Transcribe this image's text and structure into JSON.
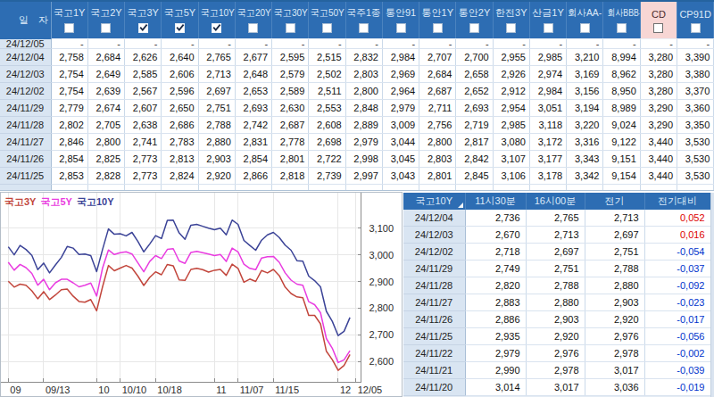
{
  "colors": {
    "header_bg": "#2D6DB3",
    "header_text": "#DCE9F8",
    "highlight_bg": "#F7D6D4",
    "highlight_text": "#4A2B2B",
    "date_col_bg": "#D9E5F2",
    "up": "#DD0000",
    "down": "#0033CC",
    "series_3y": "#C2463C",
    "series_5y": "#E93CE0",
    "series_10y": "#3B4397"
  },
  "yield_grid": {
    "date_header": "일 자",
    "columns": [
      {
        "label": "국고1Y",
        "checked": false,
        "highlighted": false
      },
      {
        "label": "국고2Y",
        "checked": false,
        "highlighted": false
      },
      {
        "label": "국고3Y",
        "checked": true,
        "highlighted": false
      },
      {
        "label": "국고5Y",
        "checked": true,
        "highlighted": false
      },
      {
        "label": "국고10Y",
        "checked": true,
        "highlighted": false
      },
      {
        "label": "국고20Y",
        "checked": false,
        "highlighted": false
      },
      {
        "label": "국고30Y",
        "checked": false,
        "highlighted": false
      },
      {
        "label": "국고50Y",
        "checked": false,
        "highlighted": false
      },
      {
        "label": "국주1종",
        "checked": false,
        "highlighted": false
      },
      {
        "label": "통안91",
        "checked": false,
        "highlighted": false
      },
      {
        "label": "통안1Y",
        "checked": false,
        "highlighted": false
      },
      {
        "label": "통안2Y",
        "checked": false,
        "highlighted": false
      },
      {
        "label": "한전3Y",
        "checked": false,
        "highlighted": false
      },
      {
        "label": "산금1Y",
        "checked": false,
        "highlighted": false
      },
      {
        "label": "회사AA-",
        "checked": false,
        "highlighted": false
      },
      {
        "label": "회사BBB-",
        "checked": false,
        "highlighted": false
      },
      {
        "label": "CD",
        "checked": false,
        "highlighted": true
      },
      {
        "label": "CP91D",
        "checked": false,
        "highlighted": false
      }
    ],
    "rows": [
      {
        "date": "24/12/05",
        "values": [
          "-",
          "-",
          "-",
          "-",
          "-",
          "-",
          "-",
          "-",
          "-",
          "-",
          "-",
          "-",
          "-",
          "-",
          "-",
          "-",
          "-",
          "-"
        ]
      },
      {
        "date": "24/12/04",
        "values": [
          "2,758",
          "2,684",
          "2,626",
          "2,640",
          "2,765",
          "2,677",
          "2,595",
          "2,515",
          "2,832",
          "2,984",
          "2,707",
          "2,700",
          "2,955",
          "2,985",
          "3,210",
          "8,994",
          "3,280",
          "3,390"
        ]
      },
      {
        "date": "24/12/03",
        "values": [
          "2,754",
          "2,649",
          "2,585",
          "2,606",
          "2,713",
          "2,648",
          "2,579",
          "2,502",
          "2,803",
          "2,969",
          "2,684",
          "2,658",
          "2,926",
          "2,974",
          "3,169",
          "8,962",
          "3,280",
          "3,380"
        ]
      },
      {
        "date": "24/12/02",
        "values": [
          "2,754",
          "2,639",
          "2,567",
          "2,596",
          "2,697",
          "2,653",
          "2,589",
          "2,511",
          "2,800",
          "2,964",
          "2,687",
          "2,652",
          "2,912",
          "2,984",
          "3,156",
          "8,950",
          "3,280",
          "3,370"
        ]
      },
      {
        "date": "24/11/29",
        "values": [
          "2,779",
          "2,674",
          "2,607",
          "2,650",
          "2,751",
          "2,693",
          "2,630",
          "2,553",
          "2,848",
          "2,979",
          "2,711",
          "2,693",
          "2,954",
          "3,051",
          "3,194",
          "8,989",
          "3,290",
          "3,360"
        ]
      },
      {
        "date": "24/11/28",
        "values": [
          "2,802",
          "2,705",
          "2,638",
          "2,686",
          "2,788",
          "2,742",
          "2,687",
          "2,608",
          "2,889",
          "3,009",
          "2,756",
          "2,719",
          "2,985",
          "3,118",
          "3,220",
          "9,024",
          "3,290",
          "3,350"
        ]
      },
      {
        "date": "24/11/27",
        "values": [
          "2,846",
          "2,800",
          "2,741",
          "2,783",
          "2,880",
          "2,831",
          "2,778",
          "2,698",
          "2,979",
          "3,044",
          "2,800",
          "2,817",
          "3,080",
          "3,172",
          "3,316",
          "9,122",
          "3,440",
          "3,530"
        ]
      },
      {
        "date": "24/11/26",
        "values": [
          "2,854",
          "2,825",
          "2,773",
          "2,813",
          "2,903",
          "2,854",
          "2,801",
          "2,722",
          "2,998",
          "3,045",
          "2,803",
          "2,842",
          "3,107",
          "3,177",
          "3,343",
          "9,151",
          "3,440",
          "3,530"
        ]
      },
      {
        "date": "24/11/25",
        "values": [
          "2,853",
          "2,828",
          "2,773",
          "2,824",
          "2,920",
          "2,866",
          "2,818",
          "2,739",
          "2,997",
          "3,043",
          "2,801",
          "2,845",
          "3,106",
          "3,178",
          "3,342",
          "9,154",
          "3,440",
          "3,530"
        ]
      }
    ]
  },
  "chart_data": {
    "type": "line",
    "x_axis": {
      "unit": "date",
      "tick_labels": [
        "09",
        "09/13",
        "10",
        "10/10",
        "10/18",
        "11",
        "11/07",
        "11/15",
        "12",
        "12/05"
      ],
      "tick_indices": [
        0,
        6,
        15,
        19,
        25,
        35,
        39,
        45,
        56,
        59
      ]
    },
    "y_axis": {
      "tick_labels": [
        "3,100",
        "3,000",
        "2,900",
        "2,800",
        "2,700",
        "2,600"
      ],
      "tick_values": [
        3.1,
        3.0,
        2.9,
        2.8,
        2.7,
        2.6
      ],
      "min": 2.546,
      "max": 3.235
    },
    "legend_position": "top-left",
    "grid": true,
    "series": [
      {
        "name": "국고3Y",
        "color": "#C2463C",
        "values": [
          2.901,
          2.879,
          2.89,
          2.886,
          2.865,
          2.835,
          2.862,
          2.832,
          2.849,
          2.869,
          2.872,
          2.845,
          2.825,
          2.822,
          2.832,
          2.79,
          2.88,
          2.96,
          2.94,
          2.95,
          2.96,
          2.95,
          2.92,
          2.885,
          2.915,
          2.936,
          2.925,
          2.964,
          2.959,
          2.906,
          2.904,
          2.945,
          2.949,
          2.944,
          2.935,
          2.942,
          2.945,
          2.923,
          2.965,
          2.949,
          2.897,
          2.909,
          2.9,
          2.941,
          2.932,
          2.945,
          2.922,
          2.879,
          2.855,
          2.842,
          2.839,
          2.773,
          2.773,
          2.741,
          2.638,
          2.607,
          2.567,
          2.585,
          2.626
        ]
      },
      {
        "name": "국고5Y",
        "color": "#E93CE0",
        "values": [
          2.972,
          2.942,
          2.964,
          2.952,
          2.93,
          2.886,
          2.908,
          2.869,
          2.895,
          2.908,
          2.908,
          2.895,
          2.88,
          2.886,
          2.894,
          2.845,
          2.95,
          3.018,
          3.001,
          3.008,
          3.011,
          3.003,
          2.97,
          2.936,
          2.975,
          2.997,
          2.986,
          3.02,
          3.023,
          2.977,
          2.968,
          3.009,
          3.013,
          3.008,
          3.003,
          2.997,
          3.001,
          2.975,
          3.025,
          3.011,
          2.965,
          2.949,
          2.944,
          2.988,
          2.993,
          2.994,
          2.972,
          2.932,
          2.905,
          2.89,
          2.886,
          2.824,
          2.813,
          2.783,
          2.686,
          2.65,
          2.596,
          2.606,
          2.64
        ]
      },
      {
        "name": "국고10Y",
        "color": "#3B4397",
        "values": [
          3.03,
          3.0,
          3.035,
          3.02,
          2.998,
          2.944,
          2.969,
          2.932,
          2.962,
          2.99,
          3.031,
          3.025,
          3.001,
          3.003,
          2.997,
          2.937,
          3.02,
          3.097,
          3.077,
          3.079,
          3.071,
          3.084,
          3.05,
          3.011,
          3.04,
          3.072,
          3.061,
          3.129,
          3.13,
          3.082,
          3.058,
          3.111,
          3.114,
          3.107,
          3.1,
          3.094,
          3.1,
          3.075,
          3.13,
          3.114,
          3.054,
          3.035,
          3.017,
          3.055,
          3.075,
          3.084,
          3.065,
          3.036,
          3.017,
          2.978,
          2.976,
          2.92,
          2.903,
          2.88,
          2.788,
          2.751,
          2.697,
          2.713,
          2.765
        ]
      }
    ]
  },
  "detail_table": {
    "columns": [
      "국고10Y",
      "11시30분",
      "16시00분",
      "전기",
      "전기대비"
    ],
    "rows": [
      {
        "date": "24/12/04",
        "t1130": "2,736",
        "t1600": "2,765",
        "prev": "2,713",
        "change": "0,052",
        "direction": "up"
      },
      {
        "date": "24/12/03",
        "t1130": "2,670",
        "t1600": "2,713",
        "prev": "2,697",
        "change": "0,016",
        "direction": "up"
      },
      {
        "date": "24/12/02",
        "t1130": "2,718",
        "t1600": "2,697",
        "prev": "2,751",
        "change": "-0,054",
        "direction": "down"
      },
      {
        "date": "24/11/29",
        "t1130": "2,749",
        "t1600": "2,751",
        "prev": "2,788",
        "change": "-0,037",
        "direction": "down"
      },
      {
        "date": "24/11/28",
        "t1130": "2,820",
        "t1600": "2,788",
        "prev": "2,880",
        "change": "-0,092",
        "direction": "down"
      },
      {
        "date": "24/11/27",
        "t1130": "2,883",
        "t1600": "2,880",
        "prev": "2,903",
        "change": "-0,023",
        "direction": "down"
      },
      {
        "date": "24/11/26",
        "t1130": "2,886",
        "t1600": "2,903",
        "prev": "2,920",
        "change": "-0,017",
        "direction": "down"
      },
      {
        "date": "24/11/25",
        "t1130": "2,935",
        "t1600": "2,920",
        "prev": "2,976",
        "change": "-0,056",
        "direction": "down"
      },
      {
        "date": "24/11/22",
        "t1130": "2,979",
        "t1600": "2,976",
        "prev": "2,978",
        "change": "-0,002",
        "direction": "down"
      },
      {
        "date": "24/11/21",
        "t1130": "2,990",
        "t1600": "2,978",
        "prev": "3,017",
        "change": "-0,039",
        "direction": "down"
      },
      {
        "date": "24/11/20",
        "t1130": "3,014",
        "t1600": "3,017",
        "prev": "3,036",
        "change": "-0,019",
        "direction": "down"
      }
    ]
  }
}
